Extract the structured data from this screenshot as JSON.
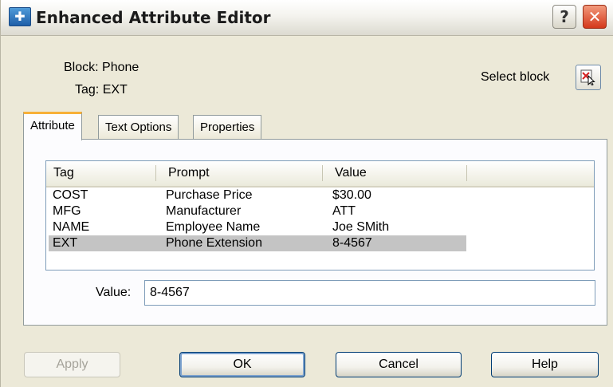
{
  "window": {
    "title": "Enhanced Attribute Editor",
    "help_glyph": "?",
    "close_glyph": "✕"
  },
  "info": {
    "block_label": "Block: Phone",
    "tag_label": "Tag: EXT",
    "select_block_label": "Select block"
  },
  "tabs": [
    {
      "label": "Attribute",
      "active": true
    },
    {
      "label": "Text Options",
      "active": false
    },
    {
      "label": "Properties",
      "active": false
    }
  ],
  "table": {
    "columns": [
      "Tag",
      "Prompt",
      "Value"
    ],
    "rows": [
      {
        "tag": "COST",
        "prompt": "Purchase Price",
        "value": "$30.00",
        "selected": false
      },
      {
        "tag": "MFG",
        "prompt": "Manufacturer",
        "value": "ATT",
        "selected": false
      },
      {
        "tag": "NAME",
        "prompt": "Employee Name",
        "value": "Joe SMith",
        "selected": false
      },
      {
        "tag": "EXT",
        "prompt": "Phone Extension",
        "value": "8-4567",
        "selected": true
      }
    ]
  },
  "value_field": {
    "label": "Value:",
    "value": "8-4567"
  },
  "buttons": {
    "apply": "Apply",
    "ok": "OK",
    "cancel": "Cancel",
    "help": "Help"
  },
  "colors": {
    "dialog_bg": "#ece9d8",
    "selected_row": "#c4c4c4",
    "close_button": "#d4381b",
    "active_tab_accent": "#f7b038"
  }
}
